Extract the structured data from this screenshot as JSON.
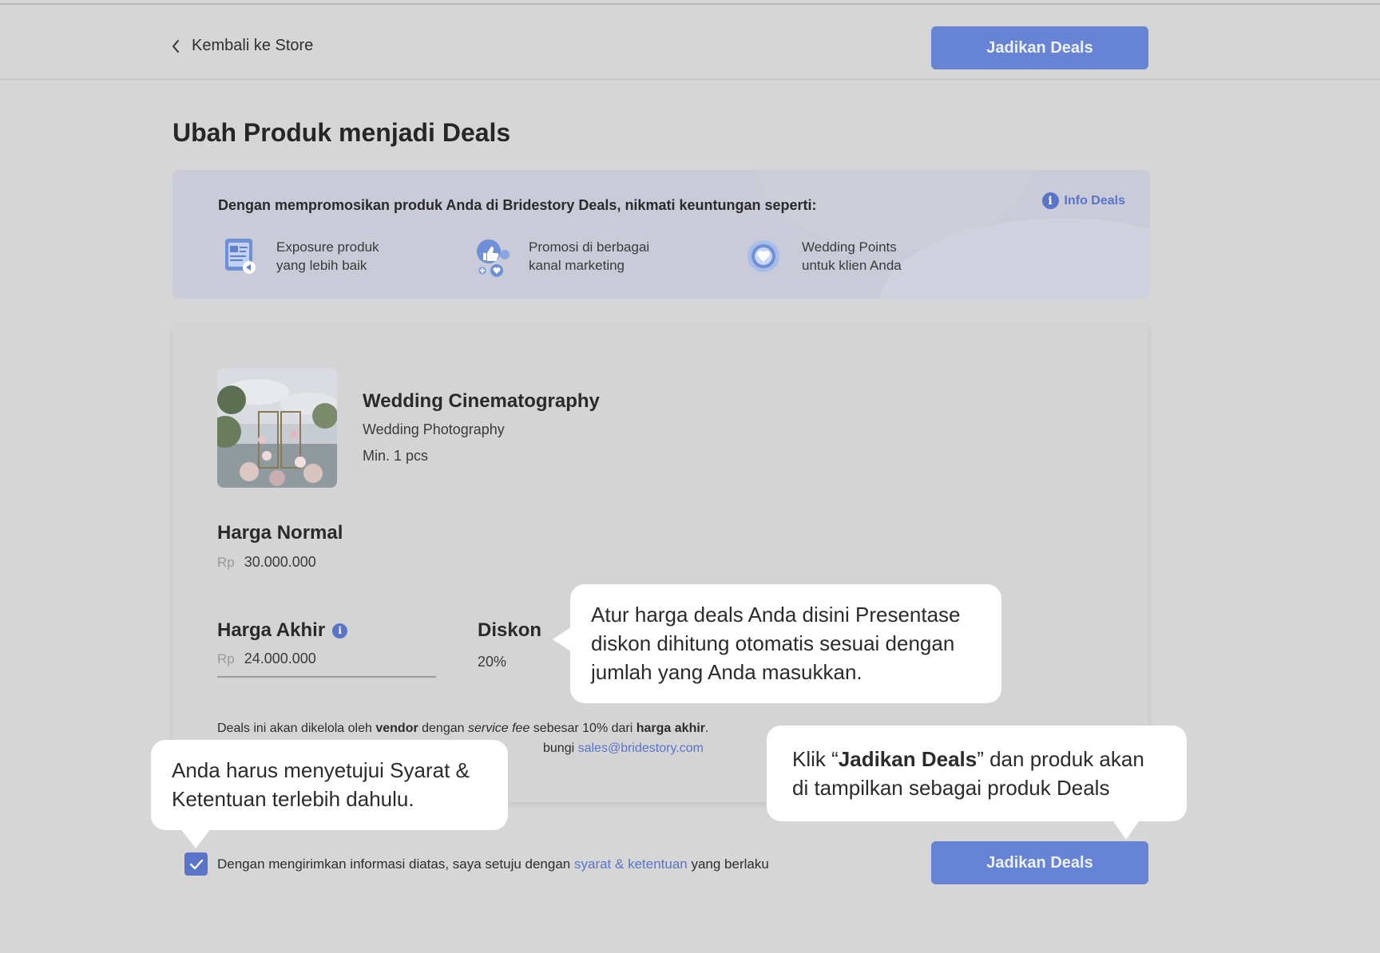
{
  "header": {
    "back_label": "Kembali ke Store",
    "cta_label": "Jadikan Deals"
  },
  "page_title": "Ubah Produk menjadi Deals",
  "banner": {
    "headline": "Dengan mempromosikan produk Anda di Bridestory Deals, nikmati keuntungan seperti:",
    "info_label": "Info Deals",
    "benefits": [
      {
        "icon": "exposure-icon",
        "line1": "Exposure produk",
        "line2": "yang lebih baik"
      },
      {
        "icon": "marketing-icon",
        "line1": "Promosi di berbagai",
        "line2": "kanal marketing"
      },
      {
        "icon": "heart-points-icon",
        "line1": "Wedding Points",
        "line2": "untuk klien Anda"
      }
    ]
  },
  "product": {
    "name": "Wedding Cinematography",
    "category": "Wedding Photography",
    "min_order": "Min. 1 pcs"
  },
  "pricing": {
    "normal_label": "Harga Normal",
    "currency": "Rp",
    "normal_value": "30.000.000",
    "final_label": "Harga Akhir",
    "final_value": "24.000.000",
    "discount_label": "Diskon",
    "discount_value": "20%"
  },
  "notes": {
    "line1_a": "Deals ini akan dikelola oleh ",
    "line1_b": "vendor",
    "line1_c": " dengan ",
    "line1_d": "service fee",
    "line1_e": " sebesar 10% dari ",
    "line1_f": "harga akhir",
    "line1_g": ".",
    "line2_visible": "bungi ",
    "line2_email": "sales@bridestory.com"
  },
  "agreement": {
    "text_before": "Dengan mengirimkan informasi diatas, saya setuju dengan ",
    "link": "syarat & ketentuan",
    "text_after": " yang berlaku",
    "checked": true
  },
  "footer_cta_label": "Jadikan Deals",
  "tooltips": {
    "price_tip": "Atur harga deals Anda disini Presentase diskon dihitung otomatis sesuai dengan jumlah yang Anda masukkan.",
    "terms_tip": "Anda harus menyetujui Syarat & Ketentuan terlebih dahulu.",
    "cta_tip_before": "Klik “",
    "cta_tip_bold": "Jadikan Deals",
    "cta_tip_after": "” dan produk akan di tampilkan sebagai produk Deals"
  },
  "colors": {
    "accent": "#6783d3",
    "link": "#5a74c8",
    "background": "#d6d6d6",
    "tooltip": "#ffffff"
  }
}
